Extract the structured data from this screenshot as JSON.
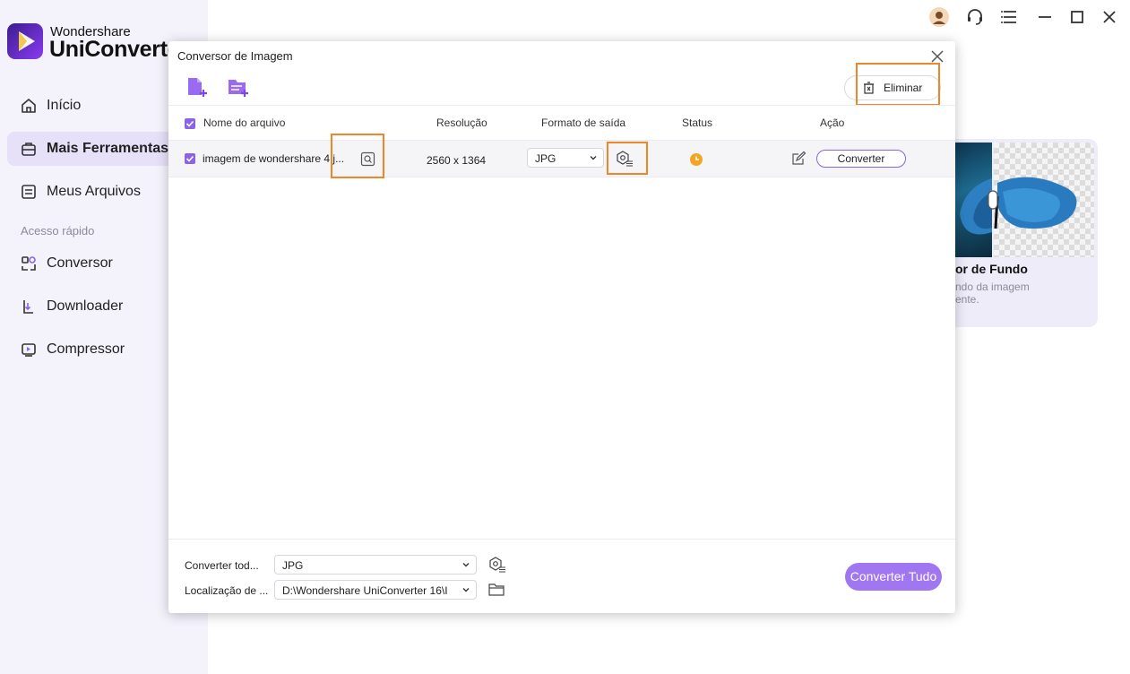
{
  "app": {
    "brand_top": "Wondershare",
    "brand_main": "UniConverter"
  },
  "sidebar": {
    "items": [
      {
        "label": "Início",
        "icon": "home-icon"
      },
      {
        "label": "Mais Ferramentas",
        "icon": "toolbox-icon",
        "active": true
      },
      {
        "label": "Meus Arquivos",
        "icon": "files-icon"
      }
    ],
    "section_label": "Acesso rápido",
    "quick": [
      {
        "label": "Conversor",
        "icon": "converter-icon"
      },
      {
        "label": "Downloader",
        "icon": "downloader-icon"
      },
      {
        "label": "Compressor",
        "icon": "compressor-icon"
      }
    ]
  },
  "background_card": {
    "title": "or de Fundo",
    "desc": "ndo da imagem ente."
  },
  "dialog": {
    "title": "Conversor de Imagem",
    "eliminar_label": "Eliminar",
    "columns": {
      "name": "Nome do arquivo",
      "resolution": "Resolução",
      "format": "Formato de saída",
      "status": "Status",
      "action": "Ação"
    },
    "rows": [
      {
        "name": "imagem de wondershare 4.j...",
        "resolution": "2560 x 1364",
        "format": "JPG",
        "status": "pending",
        "action": "Converter"
      }
    ],
    "footer": {
      "convert_all_to_label": "Converter tod...",
      "convert_all_to_value": "JPG",
      "location_label": "Localização de ...",
      "location_value": "D:\\Wondershare UniConverter 16\\I",
      "convert_all_button": "Converter Tudo"
    }
  },
  "colors": {
    "accent": "#8a63e8",
    "highlight": "#f0852a",
    "status_pending": "#f4a623"
  }
}
